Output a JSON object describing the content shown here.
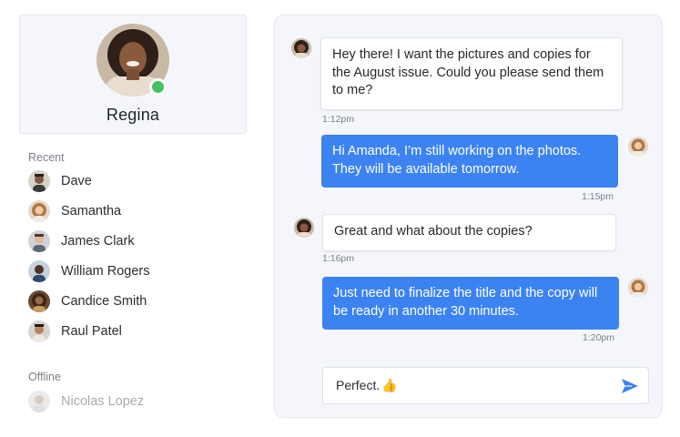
{
  "profile": {
    "name": "Regina",
    "status": "online",
    "status_color": "#42c35f"
  },
  "sidebar": {
    "recent_label": "Recent",
    "recent": [
      {
        "name": "Dave"
      },
      {
        "name": "Samantha"
      },
      {
        "name": "James Clark"
      },
      {
        "name": "William Rogers"
      },
      {
        "name": "Candice Smith"
      },
      {
        "name": "Raul Patel"
      }
    ],
    "offline_label": "Offline",
    "offline": [
      {
        "name": "Nicolas Lopez"
      }
    ]
  },
  "chat": {
    "messages": [
      {
        "direction": "incoming",
        "text": "Hey there! I want the pictures and copies for the August issue. Could you please send them to me?",
        "time": "1:12pm"
      },
      {
        "direction": "outgoing",
        "text": "Hi Amanda, I’m still working on the photos. They will be available tomorrow.",
        "time": "1:15pm"
      },
      {
        "direction": "incoming",
        "text": "Great and what about the copies?",
        "time": "1:16pm"
      },
      {
        "direction": "outgoing",
        "text": "Just need to finalize the title and the copy will be ready in another 30 minutes.",
        "time": "1:20pm"
      }
    ],
    "composer": {
      "value": "Perfect.",
      "emoji": "👍",
      "send_icon": "send-icon"
    }
  },
  "colors": {
    "accent": "#3c83f2",
    "panel_bg": "#f4f6fb"
  }
}
